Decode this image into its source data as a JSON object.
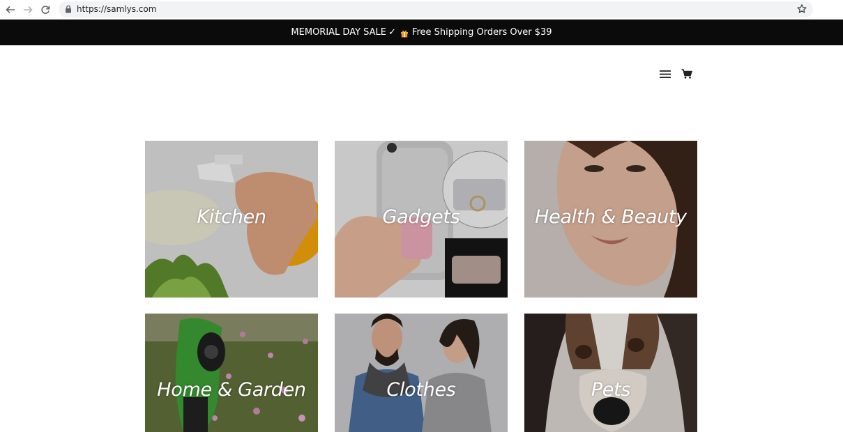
{
  "browser": {
    "url": "https://samlys.com"
  },
  "announcement": {
    "part1": "MEMORIAL DAY SALE",
    "check": "✓",
    "part2": "Free Shipping Orders Over $39"
  },
  "header": {
    "icons": [
      "menu-icon",
      "cart-icon"
    ]
  },
  "collections": [
    {
      "label": "Kitchen"
    },
    {
      "label": "Gadgets"
    },
    {
      "label": "Health & Beauty"
    },
    {
      "label": "Home & Garden"
    },
    {
      "label": "Clothes"
    },
    {
      "label": "Pets"
    }
  ]
}
